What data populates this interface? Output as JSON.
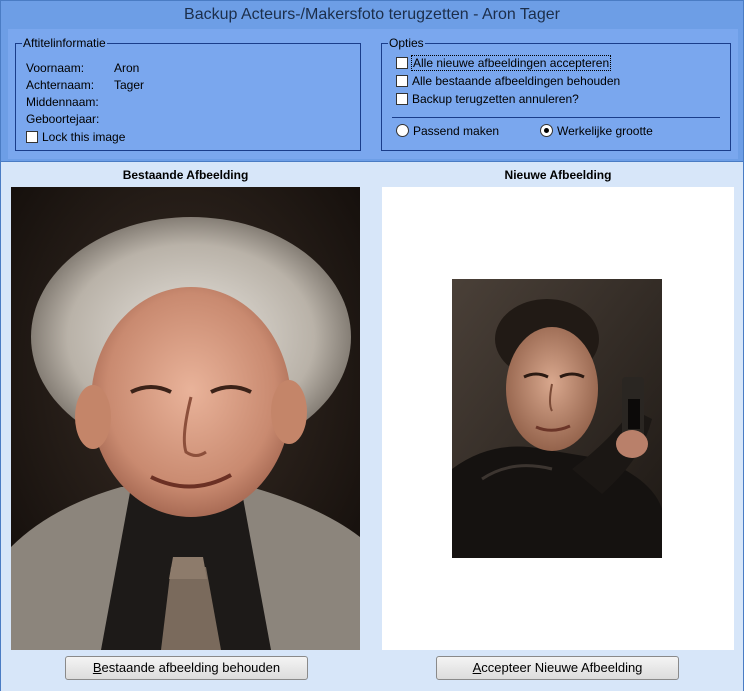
{
  "window": {
    "title": "Backup Acteurs-/Makersfoto terugzetten - Aron Tager"
  },
  "info": {
    "legend": "Aftitelinformatie",
    "rows": [
      {
        "label": "Voornaam:",
        "value": "Aron"
      },
      {
        "label": "Achternaam:",
        "value": "Tager"
      },
      {
        "label": "Middennaam:",
        "value": ""
      },
      {
        "label": "Geboortejaar:",
        "value": ""
      }
    ],
    "lock_label": "Lock this image",
    "lock_checked": false
  },
  "options": {
    "legend": "Opties",
    "checks": [
      {
        "label": "Alle nieuwe afbeeldingen accepteren",
        "checked": false,
        "focused": true
      },
      {
        "label": "Alle bestaande afbeeldingen behouden",
        "checked": false
      },
      {
        "label": "Backup terugzetten annuleren?",
        "checked": false
      }
    ],
    "radios": [
      {
        "label": "Passend maken",
        "checked": false
      },
      {
        "label": "Werkelijke grootte",
        "checked": true
      }
    ]
  },
  "existing": {
    "title": "Bestaande Afbeelding",
    "button_first": "B",
    "button_rest": "estaande afbeelding behouden"
  },
  "new": {
    "title": "Nieuwe Afbeelding",
    "button_first": "A",
    "button_rest": "ccepteer Nieuwe Afbeelding"
  }
}
